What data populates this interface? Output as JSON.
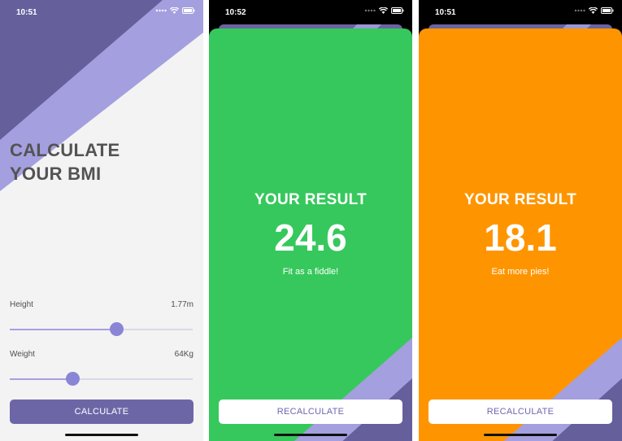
{
  "colors": {
    "purple_dark": "#655f9c",
    "purple_light": "#a49fde",
    "bg_light": "#f3f3f4",
    "green": "#36c85c",
    "orange": "#fe9500",
    "button": "#6d66a6"
  },
  "screen_calculator": {
    "status_time": "10:51",
    "title_line1": "CALCULATE",
    "title_line2": "YOUR BMI",
    "height": {
      "label": "Height",
      "value": "1.77m",
      "slider_fraction": 0.58
    },
    "weight": {
      "label": "Weight",
      "value": "64Kg",
      "slider_fraction": 0.34
    },
    "calculate_button": "CALCULATE"
  },
  "screen_result_green": {
    "status_time": "10:52",
    "result_title": "YOUR RESULT",
    "bmi_value": "24.6",
    "message": "Fit as a fiddle!",
    "recalculate_button": "RECALCULATE"
  },
  "screen_result_orange": {
    "status_time": "10:51",
    "result_title": "YOUR RESULT",
    "bmi_value": "18.1",
    "message": "Eat more pies!",
    "recalculate_button": "RECALCULATE"
  },
  "icons": [
    "signal-dots-icon",
    "wifi-icon",
    "battery-icon"
  ]
}
